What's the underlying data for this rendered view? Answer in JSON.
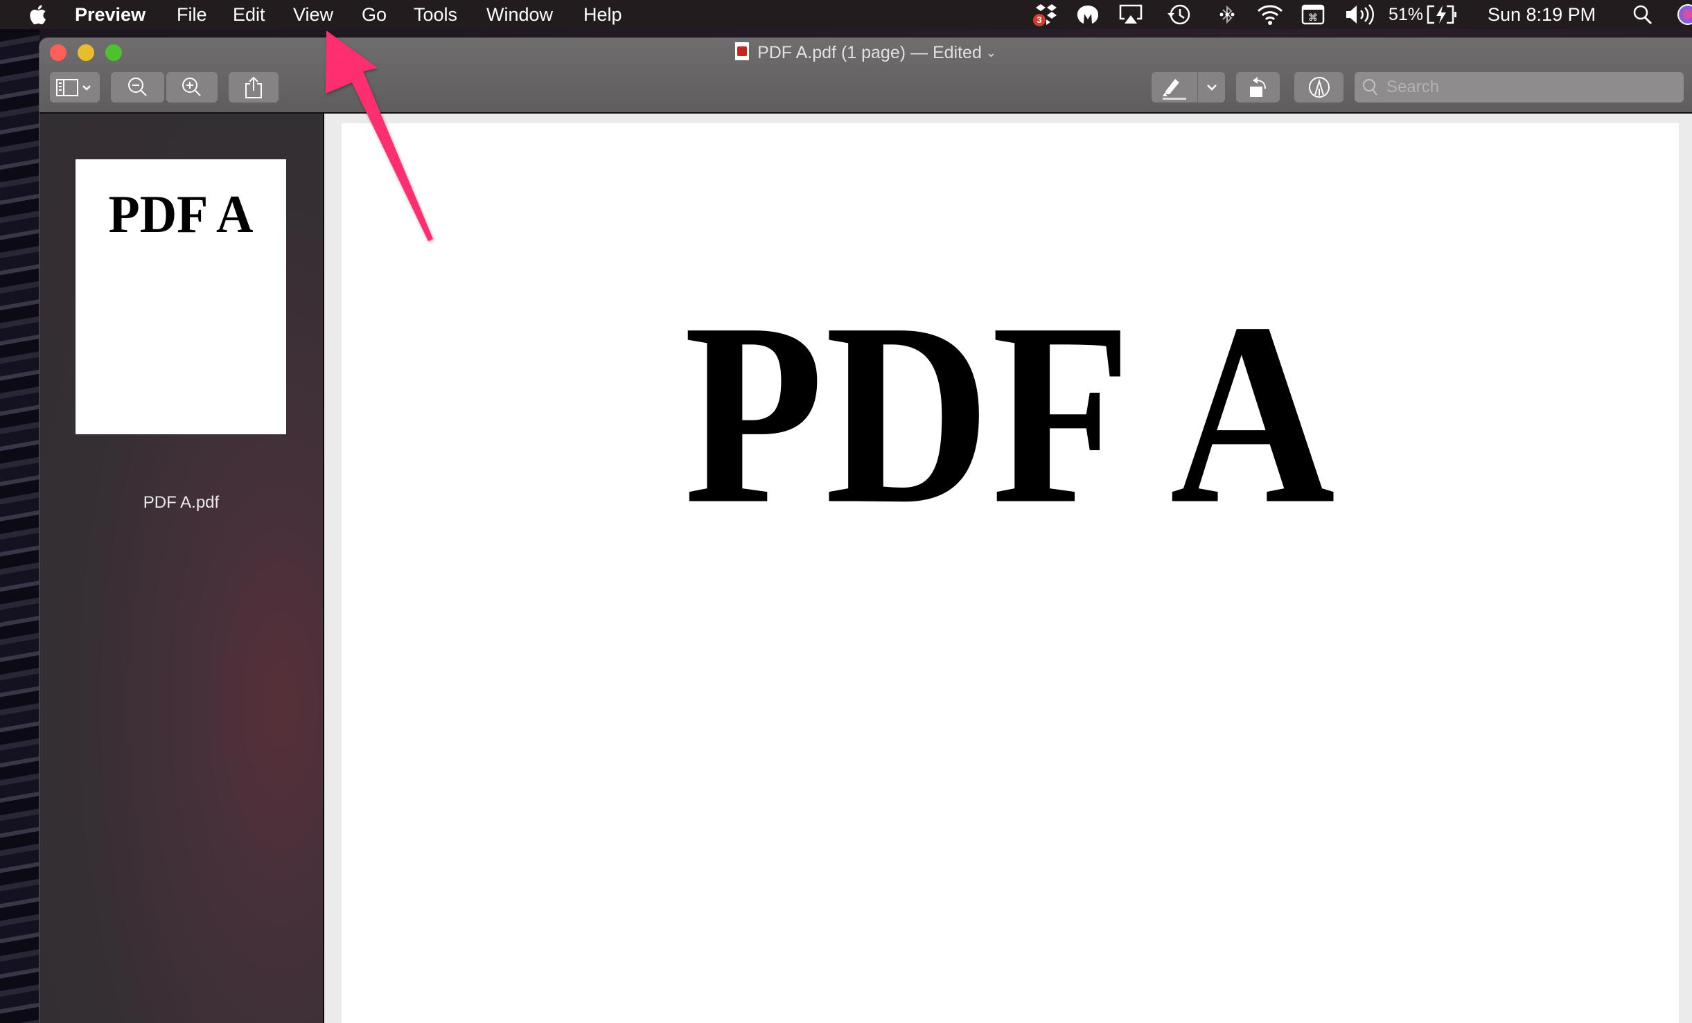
{
  "menubar": {
    "app_name": "Preview",
    "items": [
      "File",
      "Edit",
      "View",
      "Go",
      "Tools",
      "Window",
      "Help"
    ],
    "status": {
      "dropbox_badge": "3",
      "battery_percent": "51%",
      "clock": "Sun 8:19 PM"
    }
  },
  "window": {
    "title": "PDF A.pdf (1 page) — Edited",
    "toolbar": {
      "search_placeholder": "Search"
    }
  },
  "sidebar": {
    "thumbnails": [
      {
        "page_text": "PDF A",
        "label": "PDF A.pdf"
      }
    ]
  },
  "document": {
    "page_text": "PDF A"
  },
  "annotation": {
    "arrow_color": "#ff2d6f",
    "points_to": "View"
  },
  "colors": {
    "close": "#fe5f57",
    "minimize": "#e7bd2b",
    "maximize": "#4dc12e"
  }
}
